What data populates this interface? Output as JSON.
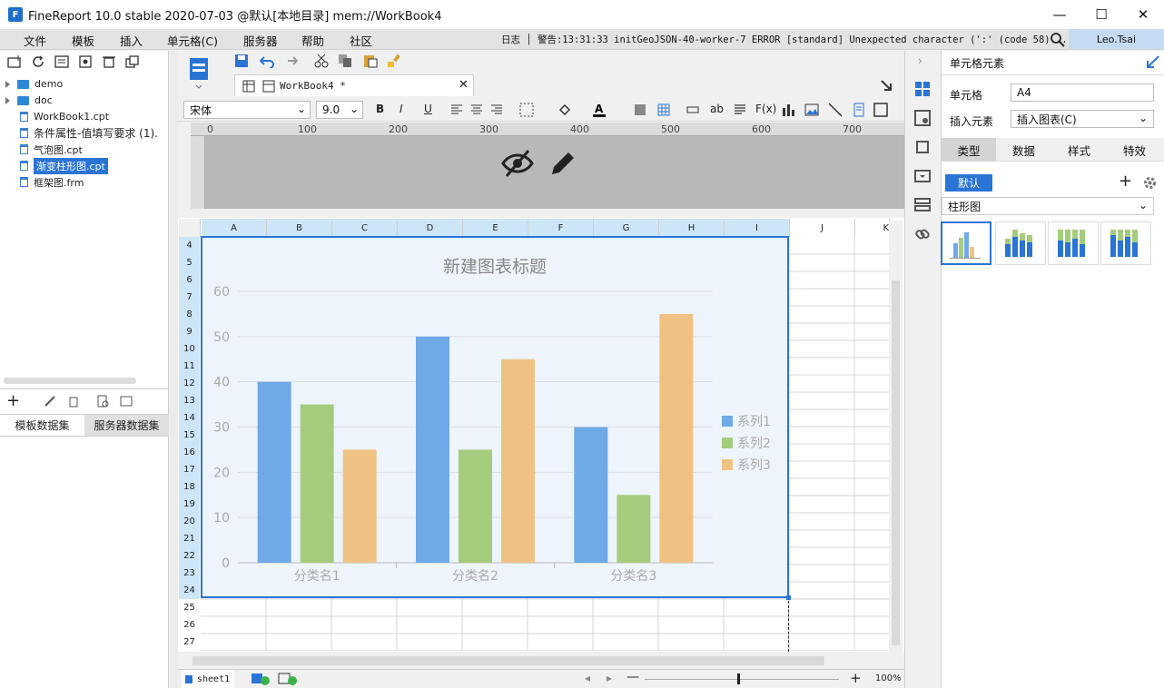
{
  "window": {
    "title": "FineReport 10.0 stable 2020-07-03 @默认[本地目录]    mem://WorkBook4",
    "minimize": "—",
    "maximize": "☐",
    "close": "✕",
    "logo": "F"
  },
  "menu": {
    "items": [
      "文件",
      "模板",
      "插入",
      "单元格(C)",
      "服务器",
      "帮助",
      "社区"
    ],
    "log": "日志 │ 警告:13:31:33 initGeoJSON-40-worker-7 ERROR [standard] Unexpected character (':' (code 58)...",
    "user": "Leo.Tsai"
  },
  "tree": {
    "items": [
      {
        "label": "demo",
        "type": "folder"
      },
      {
        "label": "doc",
        "type": "folder"
      },
      {
        "label": "WorkBook1.cpt",
        "type": "file"
      },
      {
        "label": "条件属性-值填写要求 (1).",
        "type": "file"
      },
      {
        "label": "气泡图.cpt",
        "type": "file"
      },
      {
        "label": "渐变柱形图.cpt",
        "type": "file",
        "selected": true
      },
      {
        "label": "框架图.frm",
        "type": "file"
      }
    ]
  },
  "datasets": {
    "tab1": "模板数据集",
    "tab2": "服务器数据集"
  },
  "editor": {
    "tab": "WorkBook4 *",
    "font": "宋体",
    "size": "9.0",
    "bold": "B",
    "italic": "I",
    "underline": "U",
    "ruler": [
      "0",
      "100",
      "200",
      "300",
      "400",
      "500",
      "600",
      "700"
    ]
  },
  "grid": {
    "columns": [
      "A",
      "B",
      "C",
      "D",
      "E",
      "F",
      "G",
      "H",
      "I",
      "J",
      "K"
    ],
    "rows": [
      "4",
      "5",
      "6",
      "7",
      "8",
      "9",
      "10",
      "11",
      "12",
      "13",
      "14",
      "15",
      "16",
      "17",
      "18",
      "19",
      "20",
      "21",
      "22",
      "23",
      "24",
      "25",
      "26",
      "27"
    ]
  },
  "chart_data": {
    "type": "bar",
    "title": "新建图表标题",
    "categories": [
      "分类名1",
      "分类名2",
      "分类名3"
    ],
    "series": [
      {
        "name": "系列1",
        "values": [
          40,
          50,
          30
        ],
        "color": "#6fa9e6"
      },
      {
        "name": "系列2",
        "values": [
          35,
          25,
          15
        ],
        "color": "#a4cc7c"
      },
      {
        "name": "系列3",
        "values": [
          25,
          45,
          55
        ],
        "color": "#efc283"
      }
    ],
    "yticks": [
      "0",
      "10",
      "20",
      "30",
      "40",
      "50",
      "60"
    ],
    "ylim": [
      0,
      60
    ],
    "legend": "right"
  },
  "sheet": {
    "name": "sheet1",
    "zoom": "100%"
  },
  "panel": {
    "title": "单元格元素",
    "cell_label": "单元格",
    "cell_value": "A4",
    "insert_label": "插入元素",
    "insert_value": "插入图表(C)",
    "tabs": [
      "类型",
      "数据",
      "样式",
      "特效"
    ],
    "default_btn": "默认",
    "chart_type": "柱形图"
  }
}
